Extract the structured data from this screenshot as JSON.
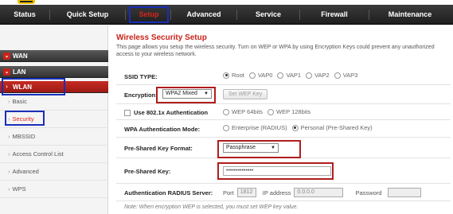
{
  "top_nav": {
    "items": [
      {
        "label": "Status"
      },
      {
        "label": "Quick Setup"
      },
      {
        "label": "Setup"
      },
      {
        "label": "Advanced"
      },
      {
        "label": "Service"
      },
      {
        "label": "Firewall"
      },
      {
        "label": "Maintenance"
      }
    ],
    "active_index": 2
  },
  "sidebar": {
    "sections": [
      {
        "label": "WAN"
      },
      {
        "label": "LAN"
      },
      {
        "label": "WLAN"
      }
    ],
    "sub_items": [
      {
        "label": "Basic"
      },
      {
        "label": "Security"
      },
      {
        "label": "MBSSID"
      },
      {
        "label": "Access Control List"
      },
      {
        "label": "Advanced"
      },
      {
        "label": "WPS"
      }
    ],
    "active_sub": "Security"
  },
  "page": {
    "title": "Wireless Security Setup",
    "description": "This page allows you setup the wireless security. Turn on WEP or WPA by using Encryption Keys could prevent any unauthorized access to your wireless network."
  },
  "form": {
    "ssid_type": {
      "label": "SSID TYPE:",
      "options": [
        "Root",
        "VAP0",
        "VAP1",
        "VAP2",
        "VAP3"
      ],
      "selected": "Root"
    },
    "encryption": {
      "label": "Encryption:",
      "value": "WPA2 Mixed",
      "set_wep_button": "Set WEP Key"
    },
    "use_8021x": {
      "label": "Use 802.1x Authentication",
      "options": [
        "WEP 64bits",
        "WEP 128bits"
      ]
    },
    "wpa_auth_mode": {
      "label": "WPA Authentication Mode:",
      "options": [
        "Enterprise (RADIUS)",
        "Personal (Pre-Shared Key)"
      ],
      "selected": "Personal (Pre-Shared Key)"
    },
    "psk_format": {
      "label": "Pre-Shared Key Format:",
      "value": "Passphrase"
    },
    "psk": {
      "label": "Pre-Shared Key:",
      "value": "••••••••••••••"
    },
    "radius": {
      "label": "Authentication RADIUS Server:",
      "port_label": "Port",
      "port_value": "1812",
      "ip_label": "IP address",
      "ip_value": "0.0.0.0",
      "password_label": "Password",
      "password_value": ""
    },
    "note": "Note: When encryption WEP is selected, you must set WEP key value."
  },
  "colors": {
    "accent_red": "#c9231b",
    "highlight_blue": "#1a2fb8",
    "highlight_red": "#b01d1d",
    "nav_bg": "#2a2a2a"
  }
}
